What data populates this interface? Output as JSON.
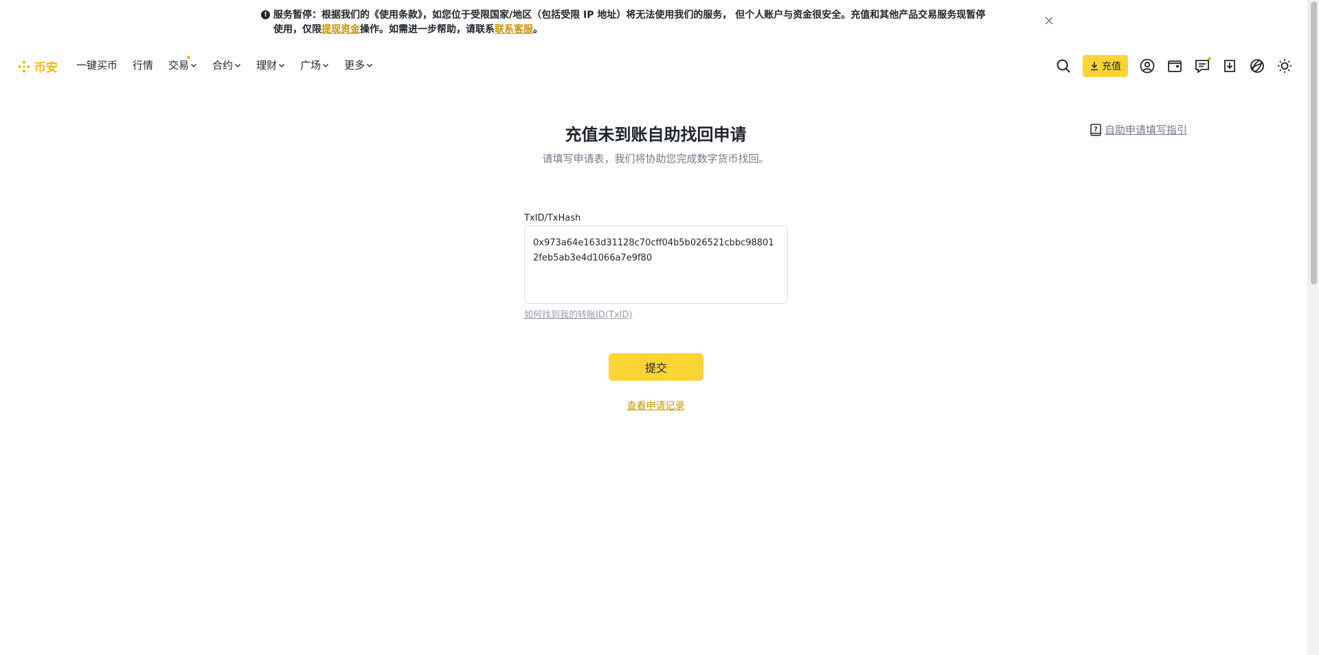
{
  "banner": {
    "icon": "exclamation-icon",
    "line1": "服务暂停：根据我们的《使用条款》，如您位于受限国家/地区（包括受限 IP 地址）将无法使用我们的服务， 但个人账户与资金很安全。充值和其他产品交易服务现暂停",
    "line2_a": "使用，仅限",
    "line2_link1": "提现资金",
    "line2_b": "操作。如需进一步帮助，请联系",
    "line2_link2": "联系客服",
    "line2_c": "。"
  },
  "nav": {
    "logo_text": "币安",
    "logo_color": "#f0b90b",
    "items": [
      {
        "label": "一键买币",
        "dropdown": false
      },
      {
        "label": "行情",
        "dropdown": false
      },
      {
        "label": "交易",
        "dropdown": true,
        "dot": true
      },
      {
        "label": "合约",
        "dropdown": true
      },
      {
        "label": "理财",
        "dropdown": true
      },
      {
        "label": "广场",
        "dropdown": true
      },
      {
        "label": "更多",
        "dropdown": true
      }
    ],
    "deposit_label": "充值",
    "right_icons": [
      "search-icon",
      "user-icon",
      "wallet-icon",
      "message-icon",
      "download-icon",
      "globe-icon",
      "theme-sun-icon"
    ]
  },
  "main": {
    "title": "充值未到账自助找回申请",
    "subtitle": "请填写申请表，我们将协助您完成数字货币找回。",
    "guide_link": "自助申请填写指引",
    "field_label": "TxID/TxHash",
    "txid_value": "0x973a64e163d31128c70cff04b5b026521cbbc988012feb5ab3e4d1066a7e9f80",
    "help_link": "如何找到我的转账ID(TxID)",
    "submit_label": "提交",
    "records_link": "查看申请记录"
  },
  "colors": {
    "accent": "#fcd535",
    "link": "#c99400",
    "muted": "#707a8a"
  }
}
